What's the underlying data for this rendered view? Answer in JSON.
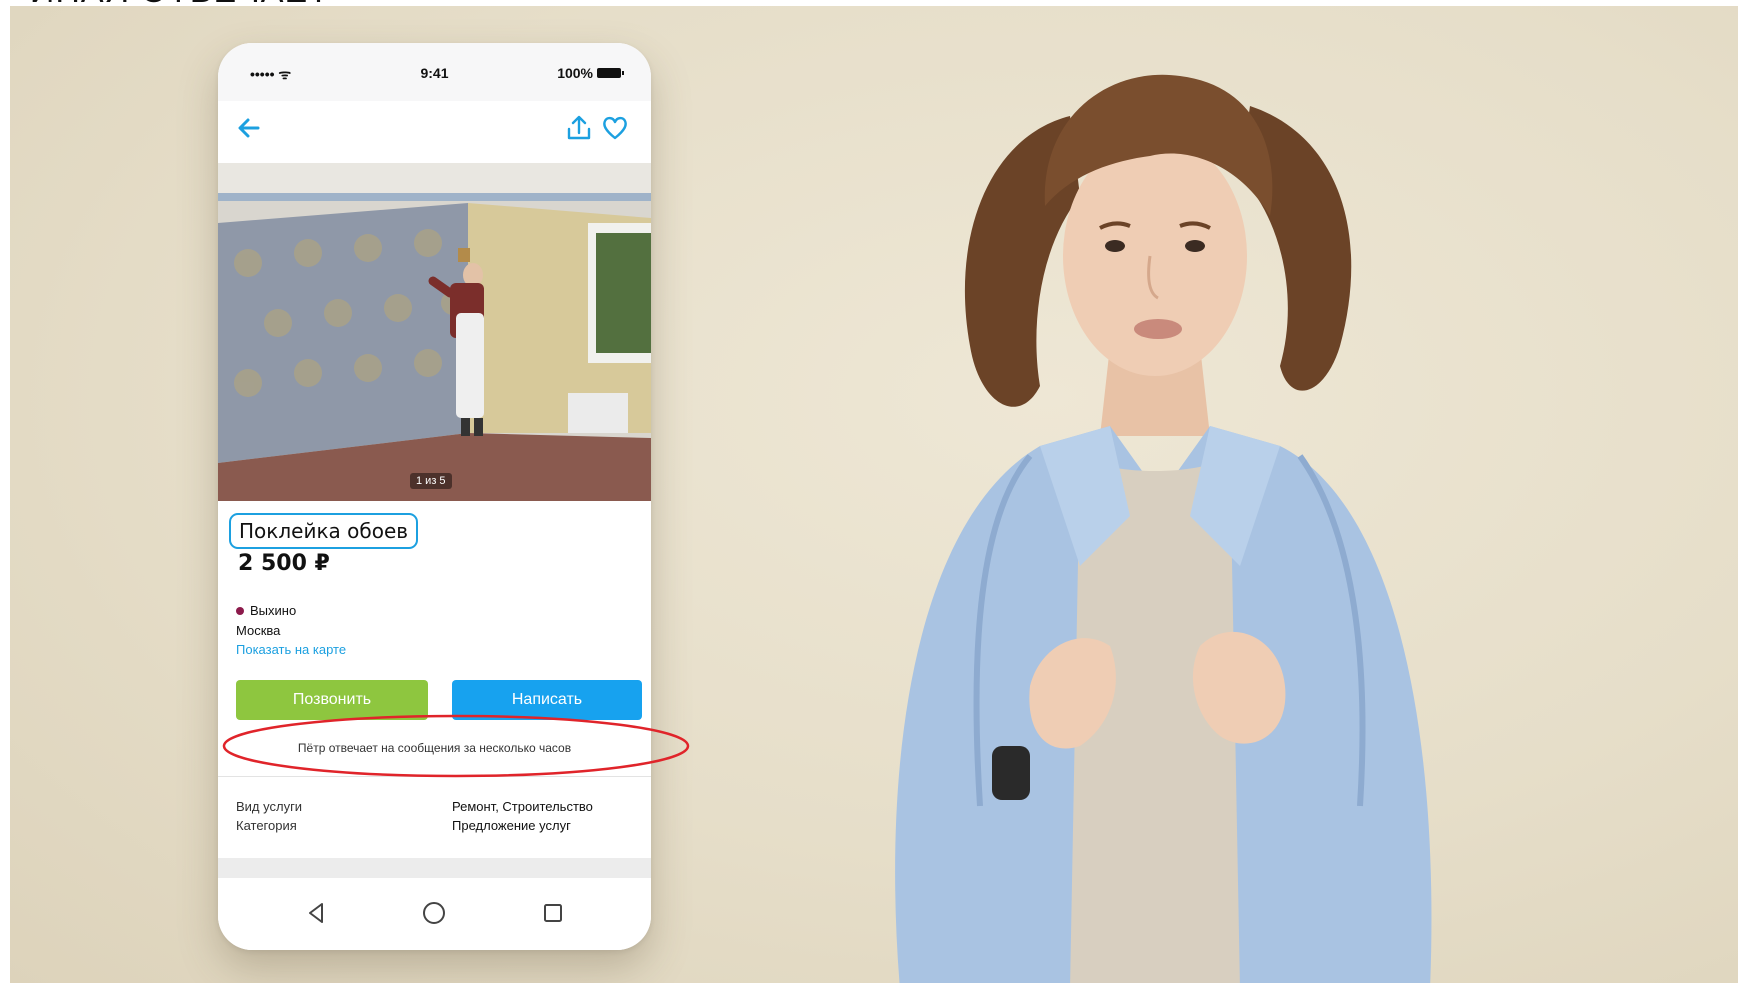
{
  "caption_top": "«ИНАЯ ОТВЕЧАЕТ»",
  "phone": {
    "status": {
      "signal": "••••• ᯤ",
      "time": "9:41",
      "battery": "100%"
    },
    "photo_counter": "1 из 5",
    "listing": {
      "title": "Поклейка обоев",
      "price": "2 500 ₽",
      "metro": "Выхино",
      "metro_color": "#8c1a4b",
      "city": "Москва",
      "map_link": "Показать на карте"
    },
    "buttons": {
      "call": "Позвонить",
      "write": "Написать"
    },
    "reply_note": "Пётр отвечает на сообщения за несколько часов",
    "params": [
      {
        "label": "Вид услуги",
        "value": "Ремонт, Строительство"
      },
      {
        "label": "Категория",
        "value": "Предложение услуг"
      }
    ]
  },
  "colors": {
    "accent_blue": "#1ca0e0",
    "call_green": "#8ec63f",
    "write_blue": "#17a2ef",
    "highlight_red": "#e0242a"
  },
  "icons": [
    "back-arrow-icon",
    "share-icon",
    "heart-icon",
    "nav-back-triangle-icon",
    "nav-home-circle-icon",
    "nav-recents-square-icon"
  ]
}
